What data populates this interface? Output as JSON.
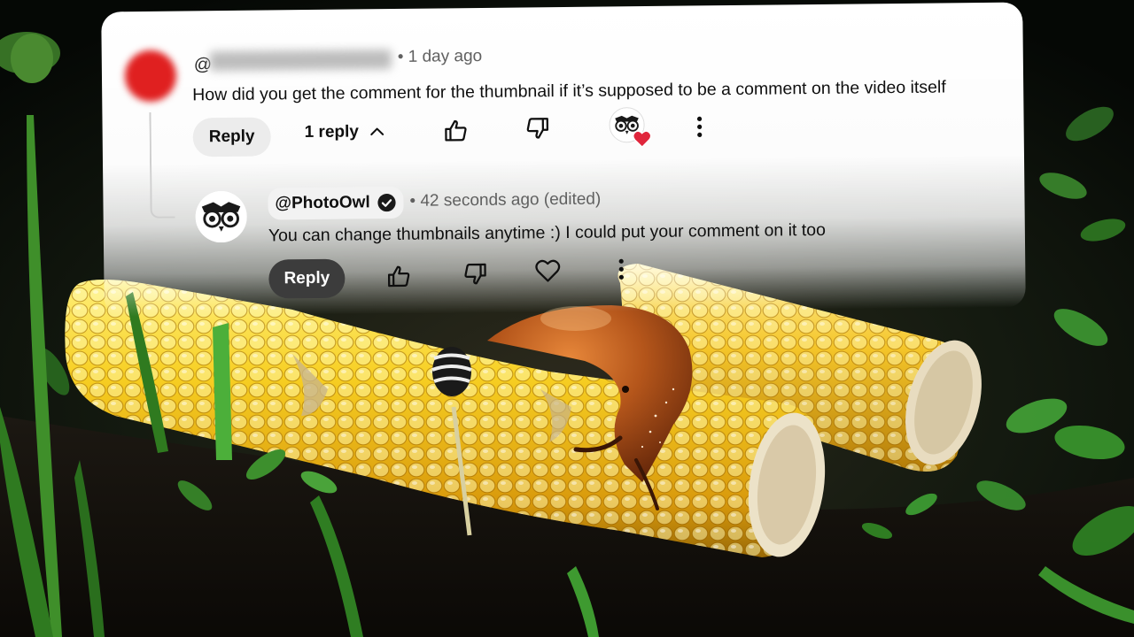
{
  "comment": {
    "author_prefix": "@",
    "timestamp": "• 1 day ago",
    "text": "How did you get the comment for the thumbnail if it’s supposed to be a comment on the video itself",
    "reply_label": "Reply",
    "replies_toggle": "1 reply",
    "like_icon": "thumbs-up-icon",
    "dislike_icon": "thumbs-down-icon",
    "more_icon": "more-vertical-icon",
    "creator_heart": "creator-heart-icon"
  },
  "reply": {
    "author": "@PhotoOwl",
    "verified_icon": "verified-check-icon",
    "timestamp": "• 42 seconds ago (edited)",
    "text": "You can change thumbnails anytime :) I could put your comment on it too",
    "reply_label": "Reply",
    "like_icon": "thumbs-up-icon",
    "dislike_icon": "thumbs-down-icon",
    "heart_icon": "heart-outline-icon",
    "more_icon": "more-vertical-icon"
  },
  "colors": {
    "heart": "#e0263c",
    "corn": "#f2c21a",
    "slug": "#b8561a",
    "grass": "#2f7a1f",
    "reply_dark": "#3c3c3c"
  }
}
